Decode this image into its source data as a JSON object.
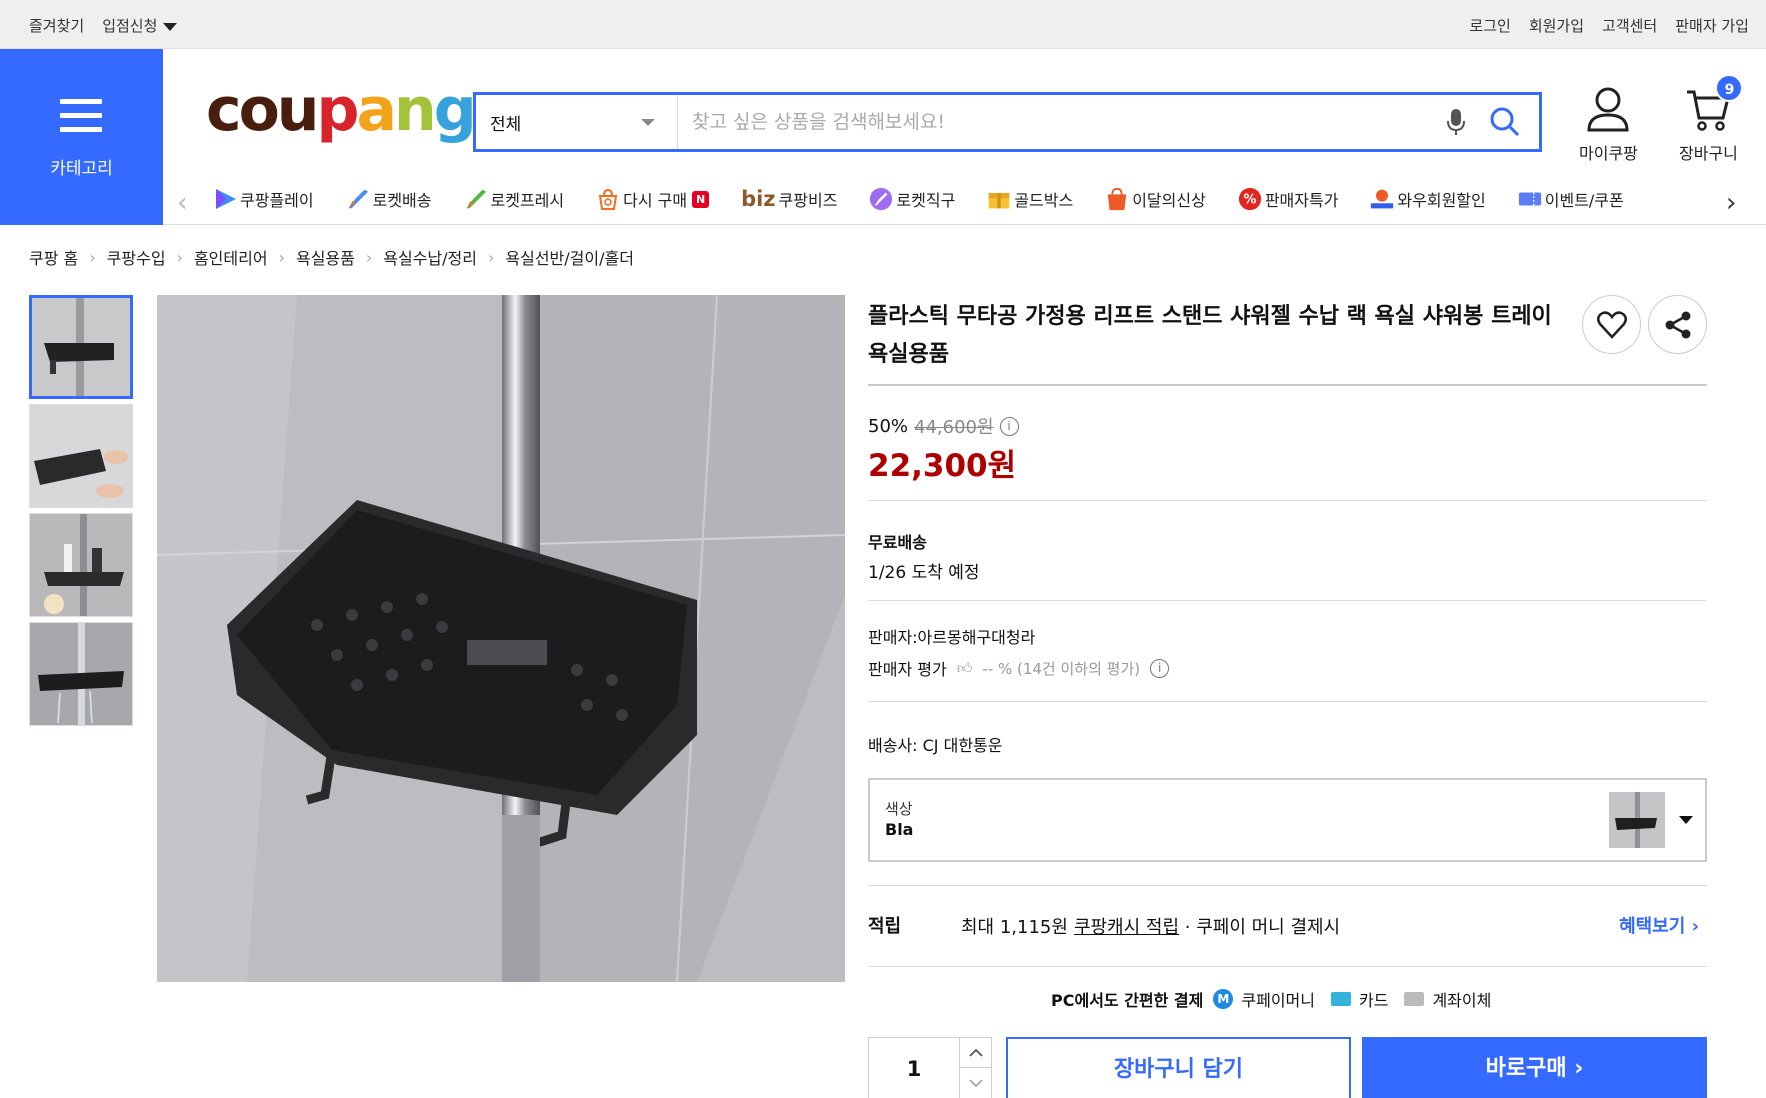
{
  "topbar": {
    "bookmark": "즐겨찾기",
    "seller_apply": "입점신청",
    "login": "로그인",
    "signup": "회원가입",
    "customer_center": "고객센터",
    "seller_signup": "판매자 가입"
  },
  "header": {
    "category_label": "카테고리",
    "logo": [
      "cou",
      "p",
      "a",
      "n",
      "g"
    ],
    "search_category": "전체",
    "search_placeholder": "찾고 싶은 상품을 검색해보세요!",
    "my_coupang": "마이쿠팡",
    "cart": "장바구니",
    "cart_count": "9"
  },
  "nav": [
    {
      "label": "쿠팡플레이",
      "icon": "play-icon"
    },
    {
      "label": "로켓배송",
      "icon": "rocket-icon"
    },
    {
      "label": "로켓프레시",
      "icon": "rocket-fresh-icon"
    },
    {
      "label": "다시 구매",
      "icon": "rebuy-icon"
    },
    {
      "label": "쿠팡비즈",
      "icon": "biz-icon"
    },
    {
      "label": "로켓직구",
      "icon": "rocket-global-icon"
    },
    {
      "label": "골드박스",
      "icon": "goldbox-icon"
    },
    {
      "label": "이달의신상",
      "icon": "new-icon"
    },
    {
      "label": "판매자특가",
      "icon": "percent-icon"
    },
    {
      "label": "와우회원할인",
      "icon": "wow-icon"
    },
    {
      "label": "이벤트/쿠폰",
      "icon": "coupon-icon"
    }
  ],
  "nav_extra": {
    "rebuy_badge": "N",
    "biz_prefix": "biz"
  },
  "breadcrumb": [
    "쿠팡 홈",
    "쿠팡수입",
    "홈인테리어",
    "욕실용품",
    "욕실수납/정리",
    "욕실선반/걸이/홀더"
  ],
  "product": {
    "title_line1": "플라스틱 무타공 가정용 리프트 스탠드 샤워젤 수납 랙 욕실 샤워봉 트레이",
    "title_line2": "욕실용품",
    "discount_rate": "50%",
    "original_price": "44,600원",
    "price": "22,300원",
    "shipping_title": "무료배송",
    "arrival": "1/26 도착 예정",
    "seller": "판매자:아르몽해구대청라",
    "seller_rating_label": "판매자 평가",
    "seller_rating_value": "-- % (14건 이하의 평가)",
    "carrier": "배송사:  CJ 대한통운",
    "option_key": "색상",
    "option_value": "Bla",
    "reward_label": "적립",
    "reward_text": "최대 1,115원",
    "reward_link": "쿠팡캐시 적립",
    "reward_sub": " · 쿠페이 머니 결제시",
    "reward_more": "혜택보기 ›",
    "pay_title": "PC에서도 간편한 결제",
    "pay_money": "쿠페이머니",
    "pay_card": "카드",
    "pay_account": "계좌이체",
    "quantity": "1",
    "add_to_cart": "장바구니 담기",
    "buy_now": "바로구매  ›"
  },
  "colors": {
    "accent": "#346aff",
    "price": "#ae0000"
  }
}
